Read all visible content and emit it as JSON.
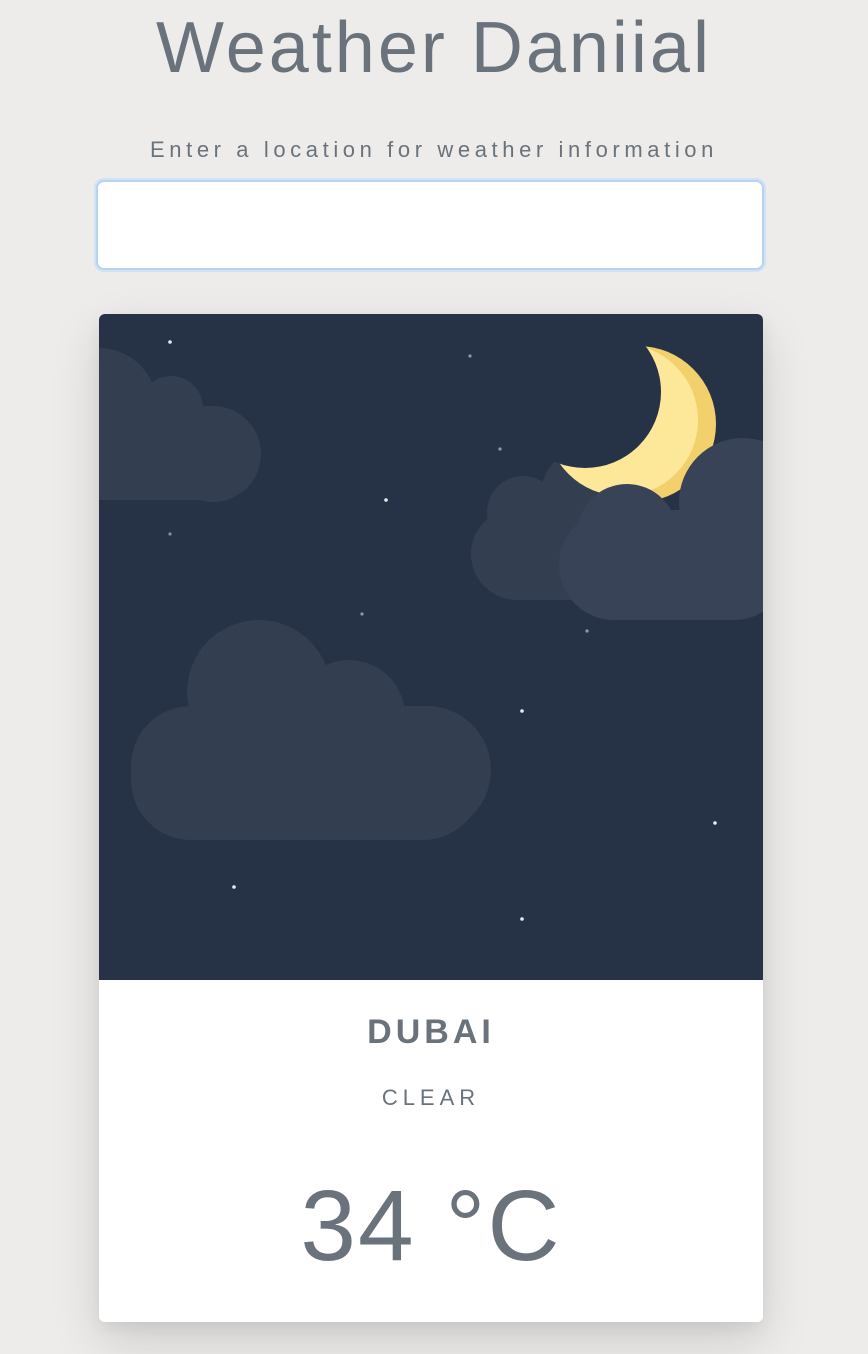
{
  "header": {
    "title": "Weather Daniial",
    "prompt": "Enter a location for weather information"
  },
  "search": {
    "value": "",
    "placeholder": ""
  },
  "weather": {
    "city": "DUBAI",
    "condition": "CLEAR",
    "temperature": "34 °C",
    "scene": "night-clear-crescent-moon-clouds"
  },
  "colors": {
    "background": "#edecea",
    "text": "#6a737c",
    "sky": "#263246",
    "cloud": "#333e50",
    "moon": "#fde89a",
    "moon_shade": "#f2d06b",
    "input_focus": "#b6d4f1"
  }
}
